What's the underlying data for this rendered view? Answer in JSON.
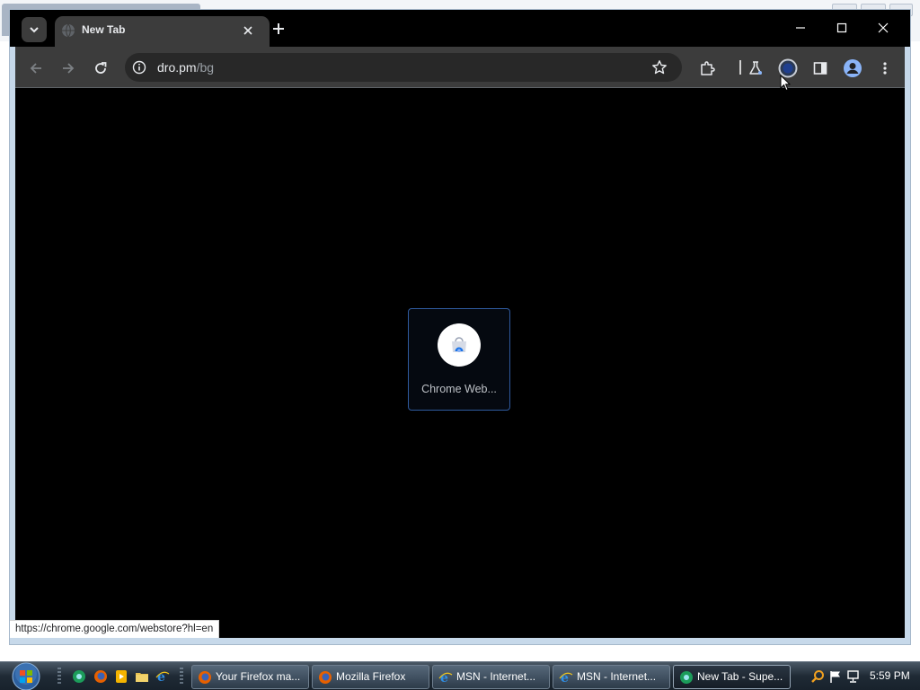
{
  "browser": {
    "tab": {
      "title": "New Tab"
    },
    "address_bar": {
      "host": "dro.pm",
      "path": "/bg"
    },
    "shortcut": {
      "title": "Chrome Web..."
    },
    "status_url": "https://chrome.google.com/webstore?hl=en",
    "theme": {
      "frame": "#000000",
      "toolbar": "#3c3c3c",
      "omnibox": "#282828",
      "accent": "#2f5a9e"
    }
  },
  "taskbar": {
    "items": [
      {
        "label": "Your Firefox ma...",
        "icon": "firefox-icon",
        "active": false
      },
      {
        "label": "Mozilla Firefox",
        "icon": "firefox-icon",
        "active": false
      },
      {
        "label": "MSN - Internet...",
        "icon": "internet-explorer-icon",
        "active": false
      },
      {
        "label": "MSN - Internet...",
        "icon": "internet-explorer-icon",
        "active": false
      },
      {
        "label": "New Tab - Supe...",
        "icon": "chrome-icon",
        "active": true
      }
    ],
    "clock": "5:59 PM"
  }
}
